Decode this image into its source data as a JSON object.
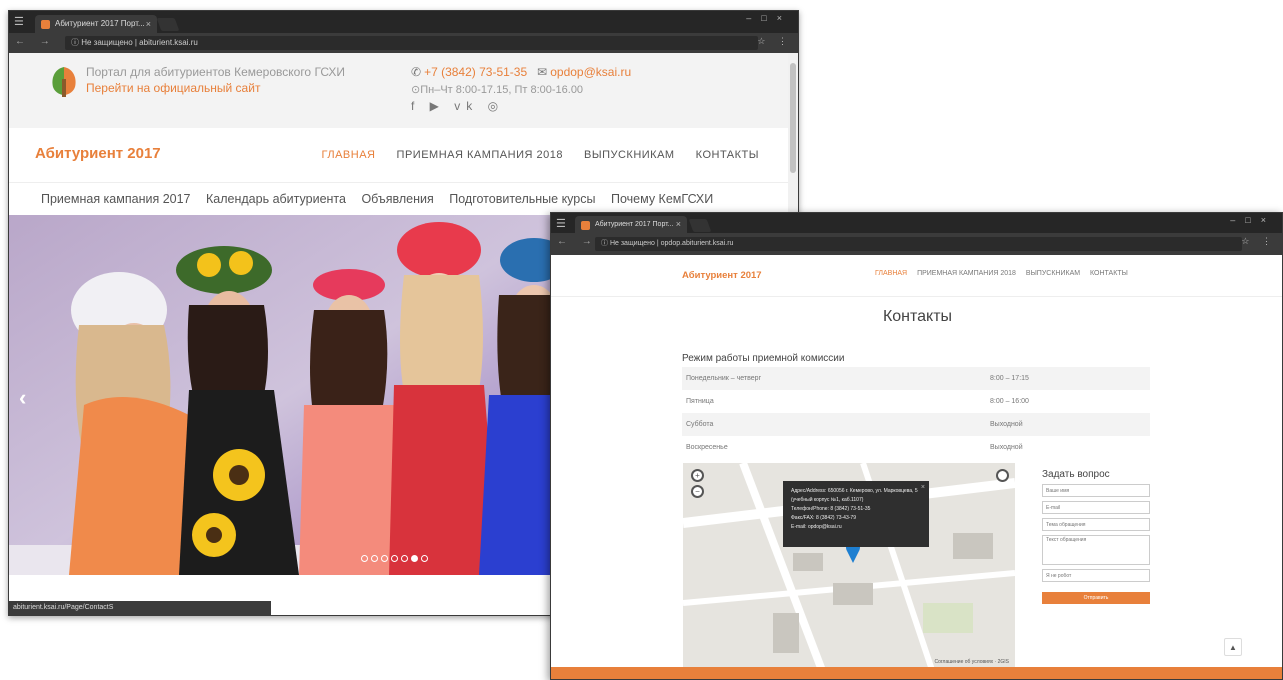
{
  "win1": {
    "tab_title": "Абитуриент 2017 Порт...",
    "tab_close": "×",
    "menu_icon": "☰",
    "window_buttons": "–□×",
    "nav_buttons": "← → C",
    "url": "ⓘ Не защищено | abiturient.ksai.ru",
    "addr_icons": "☆ ⋮",
    "portal_line1": "Портал для абитуриентов Кемеровского ГСХИ",
    "portal_line2": "Перейти на официальный сайт",
    "phone": "+7 (3842) 73-51-35",
    "email": "opdop@ksai.ru",
    "hours": "Пн–Чт 8:00-17.15, Пт 8:00-16.00",
    "social_icons": "f ▶ vk ◎",
    "brand": "Абитуриент 2017",
    "nav": [
      "ГЛАВНАЯ",
      "ПРИЕМНАЯ КАМПАНИЯ 2018",
      "ВЫПУСКНИКАМ",
      "КОНТАКТЫ"
    ],
    "subnav": [
      "Приемная кампания 2017",
      "Календарь абитуриента",
      "Объявления",
      "Подготовительные курсы",
      "Почему КемГСХИ"
    ],
    "hero_prev": "‹",
    "status_url": "abiturient.ksai.ru/Page/ContactS"
  },
  "win2": {
    "tab_title": "Абитуриент 2017 Порт...",
    "tab_close": "×",
    "menu_icon": "☰",
    "window_buttons": "–□×",
    "nav_buttons": "← → C",
    "url": "ⓘ Не защищено | opdop.abiturient.ksai.ru",
    "addr_icons": "☆ ⋮",
    "brand": "Абитуриент 2017",
    "nav": [
      "ГЛАВНАЯ",
      "ПРИЕМНАЯ КАМПАНИЯ 2018",
      "ВЫПУСКНИКАМ",
      "КОНТАКТЫ"
    ],
    "page_title": "Контакты",
    "hours_title": "Режим работы приемной комиссии",
    "hours_rows": [
      {
        "day": "Понедельник – четверг",
        "time": "8:00 – 17:15"
      },
      {
        "day": "Пятница",
        "time": "8:00 – 16:00"
      },
      {
        "day": "Суббота",
        "time": "Выходной"
      },
      {
        "day": "Воскресенье",
        "time": "Выходной"
      }
    ],
    "popup": {
      "address": "Адрес/Address: 650056 г. Кемерово, ул. Марковцева, 5 (учебный корпус №1, каб.1107)",
      "phone": "Телефон/Phone: 8 (3842) 73-51-35",
      "fax": "Факс/FAX: 8 (3842) 73-43-79",
      "email": "E-mail: opdop@ksai.ru",
      "close": "×"
    },
    "map_zoom_in": "+",
    "map_zoom_out": "−",
    "map_credit": "Соглашение об условиях · 2GIS",
    "ask": {
      "title": "Задать вопрос",
      "name_placeholder": "Ваше имя",
      "email_placeholder": "E-mail",
      "subject_placeholder": "Тема обращения",
      "message_placeholder": "Текст обращения",
      "captcha_placeholder": "Я не робот",
      "send_label": "Отправить"
    },
    "up_button": "▲"
  },
  "colors": {
    "accent": "#e8803b",
    "chrome_dark": "#262626",
    "chrome_mid": "#3b3b3b"
  }
}
